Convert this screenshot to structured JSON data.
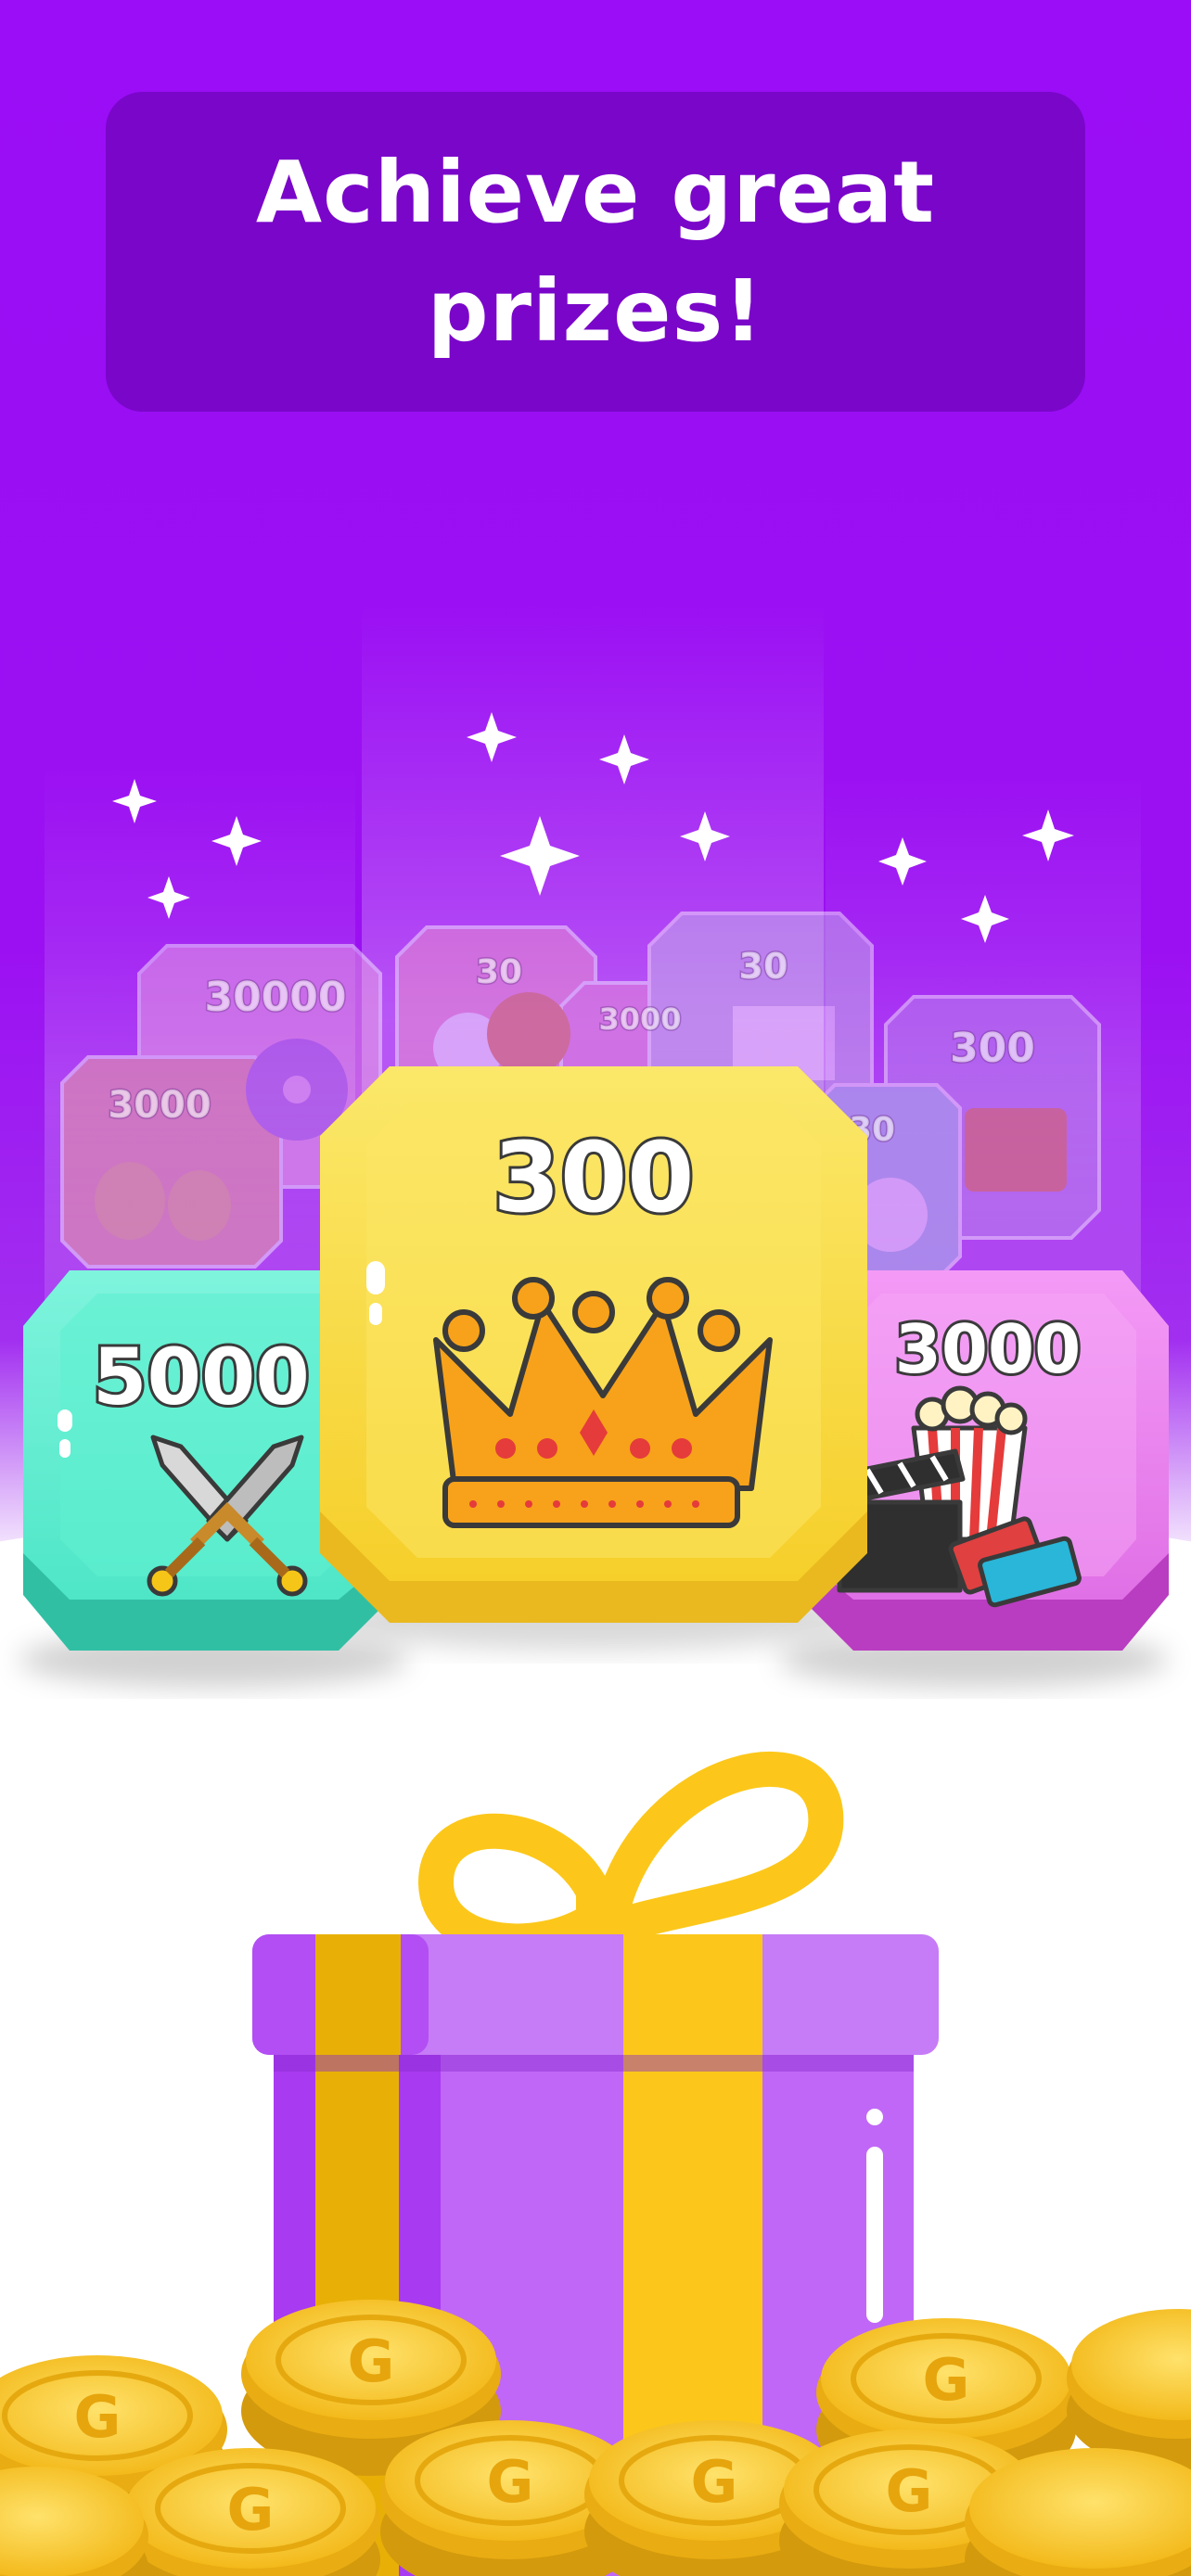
{
  "header": {
    "title": "Achieve great\nprizes!"
  },
  "cards": {
    "center": {
      "value": "300",
      "icon": "crown-icon"
    },
    "left": {
      "value": "5000",
      "icon": "crossed-swords-icon"
    },
    "right": {
      "value": "3000",
      "icon": "cinema-icon"
    }
  },
  "background_cards": [
    {
      "value": "30000",
      "icon": "music-icon"
    },
    {
      "value": "3000",
      "icon": "theater-masks-icon"
    },
    {
      "value": "30",
      "icon": "sports-balls-icon"
    },
    {
      "value": "3000",
      "icon": "trophy-icon"
    },
    {
      "value": "30",
      "icon": "stadium-icon"
    },
    {
      "value": "300",
      "icon": "travel-suitcase-icon"
    },
    {
      "value": "30",
      "icon": "soccer-ball-icon"
    }
  ],
  "coin_letter": "G",
  "colors": {
    "brand_purple": "#9a0df6",
    "title_box": "#7a06c9",
    "gold": "#f5c518",
    "teal": "#4fe6c8",
    "magenta": "#d64ad9"
  }
}
